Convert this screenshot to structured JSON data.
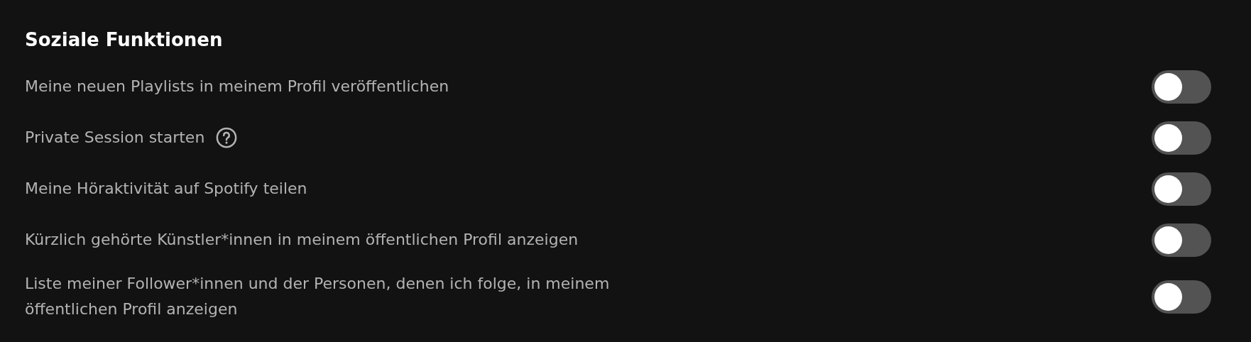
{
  "section": {
    "title": "Soziale Funktionen",
    "settings": [
      {
        "label": "Meine neuen Playlists in meinem Profil veröffentlichen",
        "help": false,
        "on": false
      },
      {
        "label": "Private Session starten",
        "help": true,
        "on": false
      },
      {
        "label": "Meine Höraktivität auf Spotify teilen",
        "help": false,
        "on": false
      },
      {
        "label": "Kürzlich gehörte Künstler*innen in meinem öffentlichen Profil anzeigen",
        "help": false,
        "on": false
      },
      {
        "label": "Liste meiner Follower*innen und der Personen, denen ich folge, in meinem öffentlichen Profil anzeigen",
        "help": false,
        "on": false
      }
    ]
  }
}
